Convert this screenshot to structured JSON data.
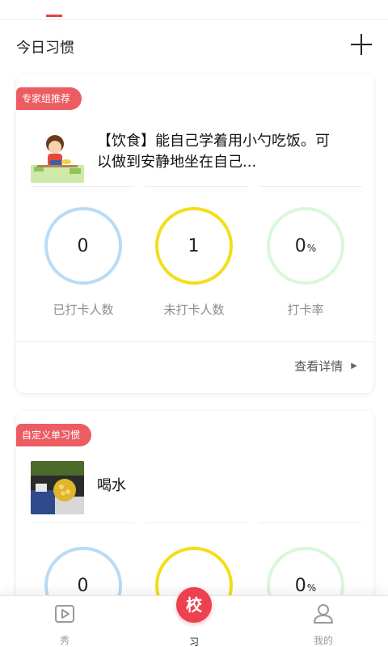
{
  "header": {
    "title": "今日习惯",
    "add_icon": "plus-icon"
  },
  "cards": [
    {
      "tag": "专家组推荐",
      "habit_text": "【饮食】能自己学着用小勺吃饭。可以做到安静地坐在自己...",
      "stats": [
        {
          "value": "0",
          "unit": "",
          "label": "已打卡人数"
        },
        {
          "value": "1",
          "unit": "",
          "label": "未打卡人数"
        },
        {
          "value": "0",
          "unit": "%",
          "label": "打卡率"
        }
      ],
      "detail_label": "查看详情",
      "detail_icon": "triangle-right-icon"
    },
    {
      "tag": "自定义单习惯",
      "habit_text": "喝水",
      "stats": [
        {
          "value": "0",
          "unit": "",
          "label": ""
        },
        {
          "value": "",
          "unit": "",
          "label": ""
        },
        {
          "value": "0",
          "unit": "%",
          "label": ""
        }
      ]
    }
  ],
  "colors": {
    "accent": "#e8433f",
    "tag_bg": "#ec5d63",
    "ring_blue": "#b7dcf7",
    "ring_yellow": "#f4de1b",
    "ring_green": "#d9f8d9"
  },
  "tabbar": {
    "tabs": [
      {
        "label": "秀",
        "icon": "video-play-icon"
      },
      {
        "label": "习",
        "icon": "school-badge-icon"
      },
      {
        "label": "我的",
        "icon": "person-icon"
      }
    ],
    "center_button_label": "校"
  }
}
